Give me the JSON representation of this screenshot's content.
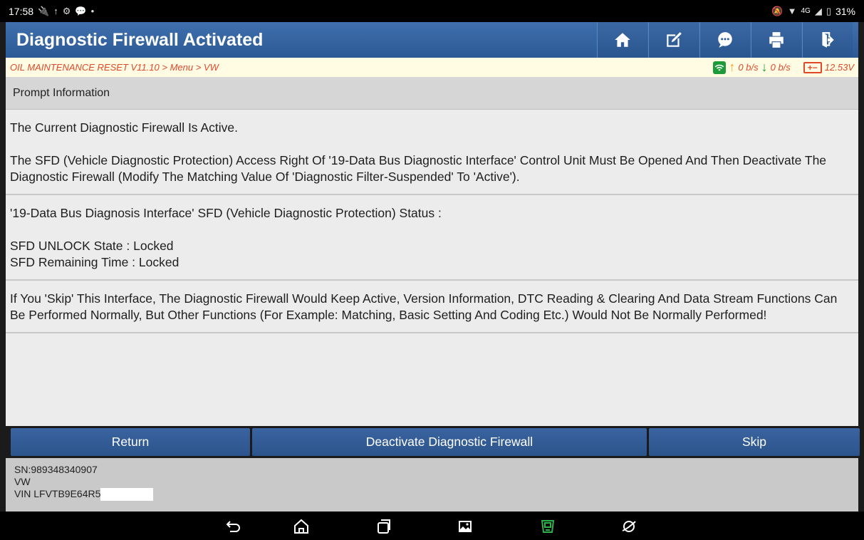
{
  "status_bar": {
    "time": "17:58",
    "left_icons": [
      "usb-icon",
      "upload-icon",
      "settings-icon",
      "chat-icon",
      "dot-icon"
    ],
    "right_text": "4G",
    "battery": "31%"
  },
  "titlebar": {
    "title": "Diagnostic Firewall Activated",
    "buttons": [
      "home-icon",
      "edit-icon",
      "message-icon",
      "print-icon",
      "exit-icon"
    ]
  },
  "breadcrumb": {
    "path": "OIL MAINTENANCE RESET V11.10 > Menu > VW",
    "upload_rate": "0 b/s",
    "download_rate": "0 b/s",
    "voltage": "12.53V",
    "battery_symbol": "+−"
  },
  "prompt": {
    "header": "Prompt Information",
    "block1_line1": "The Current Diagnostic Firewall Is Active.",
    "block1_line2": "The SFD (Vehicle Diagnostic Protection) Access Right Of '19-Data Bus Diagnostic Interface' Control Unit Must Be Opened And Then Deactivate The Diagnostic Firewall (Modify The Matching Value Of 'Diagnostic Filter-Suspended' To 'Active').",
    "block2_line1": "'19-Data Bus Diagnosis Interface' SFD (Vehicle Diagnostic Protection) Status :",
    "block2_line2": "SFD UNLOCK State : Locked",
    "block2_line3": "SFD Remaining Time : Locked",
    "block3": "If You 'Skip' This Interface, The Diagnostic Firewall Would Keep Active,  Version Information, DTC Reading & Clearing And Data Stream Functions Can Be Performed Normally, But Other Functions (For Example: Matching, Basic Setting And Coding Etc.) Would Not Be Normally Performed!"
  },
  "actions": {
    "return_label": "Return",
    "deactivate_label": "Deactivate Diagnostic Firewall",
    "skip_label": "Skip"
  },
  "footer": {
    "sn": "SN:989348340907",
    "make": "VW",
    "vin": "VIN LFVTB9E64R5"
  },
  "navbar": {
    "icons": [
      "back-icon",
      "home-icon",
      "recents-icon",
      "gallery-icon",
      "vci-icon",
      "browser-icon"
    ],
    "vci_color": "#2db34a"
  }
}
